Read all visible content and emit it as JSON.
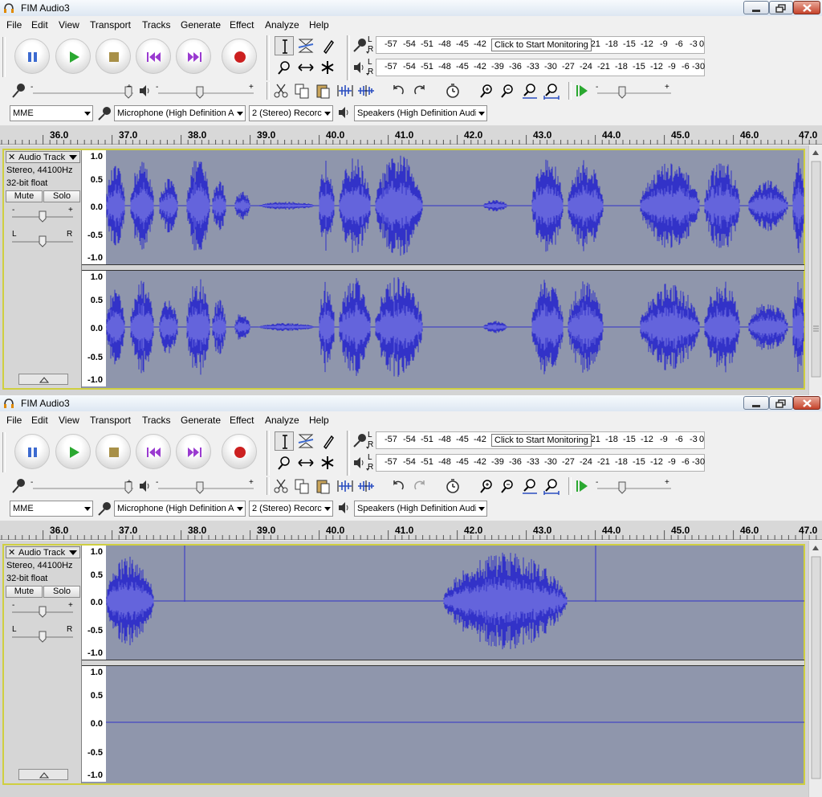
{
  "windows": [
    {
      "title": "FIM Audio3",
      "menu": [
        "File",
        "Edit",
        "View",
        "Transport",
        "Tracks",
        "Generate",
        "Effect",
        "Analyze",
        "Help"
      ],
      "meter_ticks": [
        "-57",
        "-54",
        "-51",
        "-48",
        "-45",
        "-42",
        "-39",
        "-36",
        "-33",
        "-30",
        "-27",
        "-24",
        "-21",
        "-18",
        "-15",
        "-12",
        "-9",
        "-6",
        "-3",
        "0"
      ],
      "monitor_tip": "Click to Start Monitoring",
      "meter_channels": [
        "L",
        "R"
      ],
      "host": "MME",
      "input_device": "Microphone (High Definition Au",
      "channels": "2 (Stereo) Recorc",
      "output_device": "Speakers (High Definition Audi",
      "ruler": [
        "36.0",
        "37.0",
        "38.0",
        "39.0",
        "40.0",
        "41.0",
        "42.0",
        "43.0",
        "44.0",
        "45.0",
        "46.0",
        "47.0"
      ],
      "track": {
        "name": "Audio Track",
        "close": "✕",
        "format": "Stereo, 44100Hz",
        "bitdepth": "32-bit float",
        "mute": "Mute",
        "solo": "Solo",
        "gain_minus": "-",
        "gain_plus": "+",
        "pan_left": "L",
        "pan_right": "R",
        "scale": [
          "1.0",
          "0.5",
          "0.0",
          "-0.5",
          "-1.0"
        ]
      },
      "wave_color": "#3232c8",
      "wave_light": "#6464dc",
      "redo_enabled": true
    },
    {
      "title": "FIM Audio3",
      "menu": [
        "File",
        "Edit",
        "View",
        "Transport",
        "Tracks",
        "Generate",
        "Effect",
        "Analyze",
        "Help"
      ],
      "meter_ticks": [
        "-57",
        "-54",
        "-51",
        "-48",
        "-45",
        "-42",
        "-39",
        "-36",
        "-33",
        "-30",
        "-27",
        "-24",
        "-21",
        "-18",
        "-15",
        "-12",
        "-9",
        "-6",
        "-3",
        "0"
      ],
      "monitor_tip": "Click to Start Monitoring",
      "meter_channels": [
        "L",
        "R"
      ],
      "host": "MME",
      "input_device": "Microphone (High Definition Au",
      "channels": "2 (Stereo) Recorc",
      "output_device": "Speakers (High Definition Audi",
      "ruler": [
        "36.0",
        "37.0",
        "38.0",
        "39.0",
        "40.0",
        "41.0",
        "42.0",
        "43.0",
        "44.0",
        "45.0",
        "46.0",
        "47.0"
      ],
      "track": {
        "name": "Audio Track",
        "close": "✕",
        "format": "Stereo, 44100Hz",
        "bitdepth": "32-bit float",
        "mute": "Mute",
        "solo": "Solo",
        "gain_minus": "-",
        "gain_plus": "+",
        "pan_left": "L",
        "pan_right": "R",
        "scale": [
          "1.0",
          "0.5",
          "0.0",
          "-0.5",
          "-1.0"
        ]
      },
      "wave_color": "#3232c8",
      "wave_light": "#6464dc",
      "redo_enabled": false
    }
  ]
}
